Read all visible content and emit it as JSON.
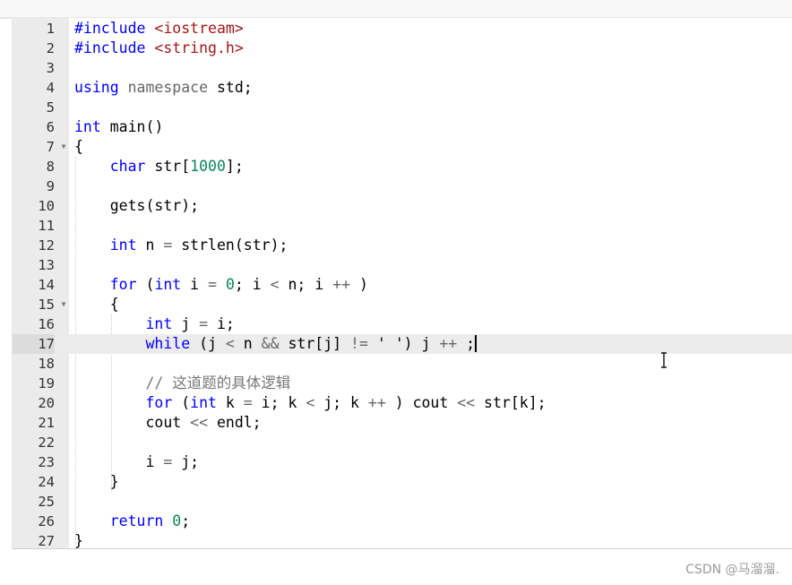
{
  "editor": {
    "language": "C++",
    "active_line": 17,
    "lines": [
      {
        "n": "1",
        "tokens": [
          [
            "kw",
            "#include"
          ],
          [
            "",
            " "
          ],
          [
            "inc",
            "<iostream>"
          ]
        ]
      },
      {
        "n": "2",
        "tokens": [
          [
            "kw",
            "#include"
          ],
          [
            "",
            " "
          ],
          [
            "inc",
            "<string.h>"
          ]
        ]
      },
      {
        "n": "3",
        "tokens": []
      },
      {
        "n": "4",
        "tokens": [
          [
            "kw",
            "using"
          ],
          [
            "",
            " "
          ],
          [
            "mod",
            "namespace"
          ],
          [
            "",
            " std;"
          ]
        ]
      },
      {
        "n": "5",
        "tokens": []
      },
      {
        "n": "6",
        "tokens": [
          [
            "kw",
            "int"
          ],
          [
            "",
            " main()"
          ]
        ]
      },
      {
        "n": "7",
        "fold": true,
        "tokens": [
          [
            "",
            "{"
          ]
        ]
      },
      {
        "n": "8",
        "tokens": [
          [
            "",
            "    "
          ],
          [
            "kw",
            "char"
          ],
          [
            "",
            " str["
          ],
          [
            "num",
            "1000"
          ],
          [
            "",
            "];"
          ]
        ]
      },
      {
        "n": "9",
        "tokens": []
      },
      {
        "n": "10",
        "tokens": [
          [
            "",
            "    gets(str);"
          ]
        ]
      },
      {
        "n": "11",
        "tokens": []
      },
      {
        "n": "12",
        "tokens": [
          [
            "",
            "    "
          ],
          [
            "kw",
            "int"
          ],
          [
            "",
            " n "
          ],
          [
            "op",
            "="
          ],
          [
            "",
            " strlen(str);"
          ]
        ]
      },
      {
        "n": "13",
        "tokens": []
      },
      {
        "n": "14",
        "tokens": [
          [
            "",
            "    "
          ],
          [
            "kw",
            "for"
          ],
          [
            "",
            " ("
          ],
          [
            "kw",
            "int"
          ],
          [
            "",
            " i "
          ],
          [
            "op",
            "="
          ],
          [
            "",
            " "
          ],
          [
            "num",
            "0"
          ],
          [
            "",
            "; i "
          ],
          [
            "op",
            "<"
          ],
          [
            "",
            " n; i "
          ],
          [
            "op",
            "++"
          ],
          [
            "",
            " )"
          ]
        ]
      },
      {
        "n": "15",
        "fold": true,
        "tokens": [
          [
            "",
            "    {"
          ]
        ]
      },
      {
        "n": "16",
        "tokens": [
          [
            "",
            "        "
          ],
          [
            "kw",
            "int"
          ],
          [
            "",
            " j "
          ],
          [
            "op",
            "="
          ],
          [
            "",
            " i;"
          ]
        ]
      },
      {
        "n": "17",
        "tokens": [
          [
            "",
            "        "
          ],
          [
            "kw",
            "while"
          ],
          [
            "",
            " (j "
          ],
          [
            "op",
            "<"
          ],
          [
            "",
            " n "
          ],
          [
            "op",
            "&&"
          ],
          [
            "",
            " str[j] "
          ],
          [
            "op",
            "!="
          ],
          [
            "",
            " ' ') j "
          ],
          [
            "op",
            "++"
          ],
          [
            "",
            " ;"
          ]
        ]
      },
      {
        "n": "18",
        "tokens": []
      },
      {
        "n": "19",
        "tokens": [
          [
            "",
            "        "
          ],
          [
            "cm",
            "// 这道题的具体逻辑"
          ]
        ]
      },
      {
        "n": "20",
        "tokens": [
          [
            "",
            "        "
          ],
          [
            "kw",
            "for"
          ],
          [
            "",
            " ("
          ],
          [
            "kw",
            "int"
          ],
          [
            "",
            " k "
          ],
          [
            "op",
            "="
          ],
          [
            "",
            " i; k "
          ],
          [
            "op",
            "<"
          ],
          [
            "",
            " j; k "
          ],
          [
            "op",
            "++"
          ],
          [
            "",
            " ) cout "
          ],
          [
            "op",
            "<<"
          ],
          [
            "",
            " str[k];"
          ]
        ]
      },
      {
        "n": "21",
        "tokens": [
          [
            "",
            "        cout "
          ],
          [
            "op",
            "<<"
          ],
          [
            "",
            " endl;"
          ]
        ]
      },
      {
        "n": "22",
        "tokens": []
      },
      {
        "n": "23",
        "tokens": [
          [
            "",
            "        i "
          ],
          [
            "op",
            "="
          ],
          [
            "",
            " j;"
          ]
        ]
      },
      {
        "n": "24",
        "tokens": [
          [
            "",
            "    }"
          ]
        ]
      },
      {
        "n": "25",
        "tokens": []
      },
      {
        "n": "26",
        "tokens": [
          [
            "",
            "    "
          ],
          [
            "kw",
            "return"
          ],
          [
            "",
            " "
          ],
          [
            "num",
            "0"
          ],
          [
            "",
            ";"
          ]
        ]
      },
      {
        "n": "27",
        "tokens": [
          [
            "",
            "}"
          ]
        ]
      }
    ]
  },
  "icons": {
    "fold": "fold-arrow-icon",
    "cursor": "text-cursor-icon"
  },
  "colors": {
    "keyword": "#0000ff",
    "include": "#a31515",
    "number": "#098658",
    "comment": "#777777",
    "gutter": "#ebebeb",
    "active_line": "#ececec"
  },
  "watermark": "CSDN @马溜溜."
}
